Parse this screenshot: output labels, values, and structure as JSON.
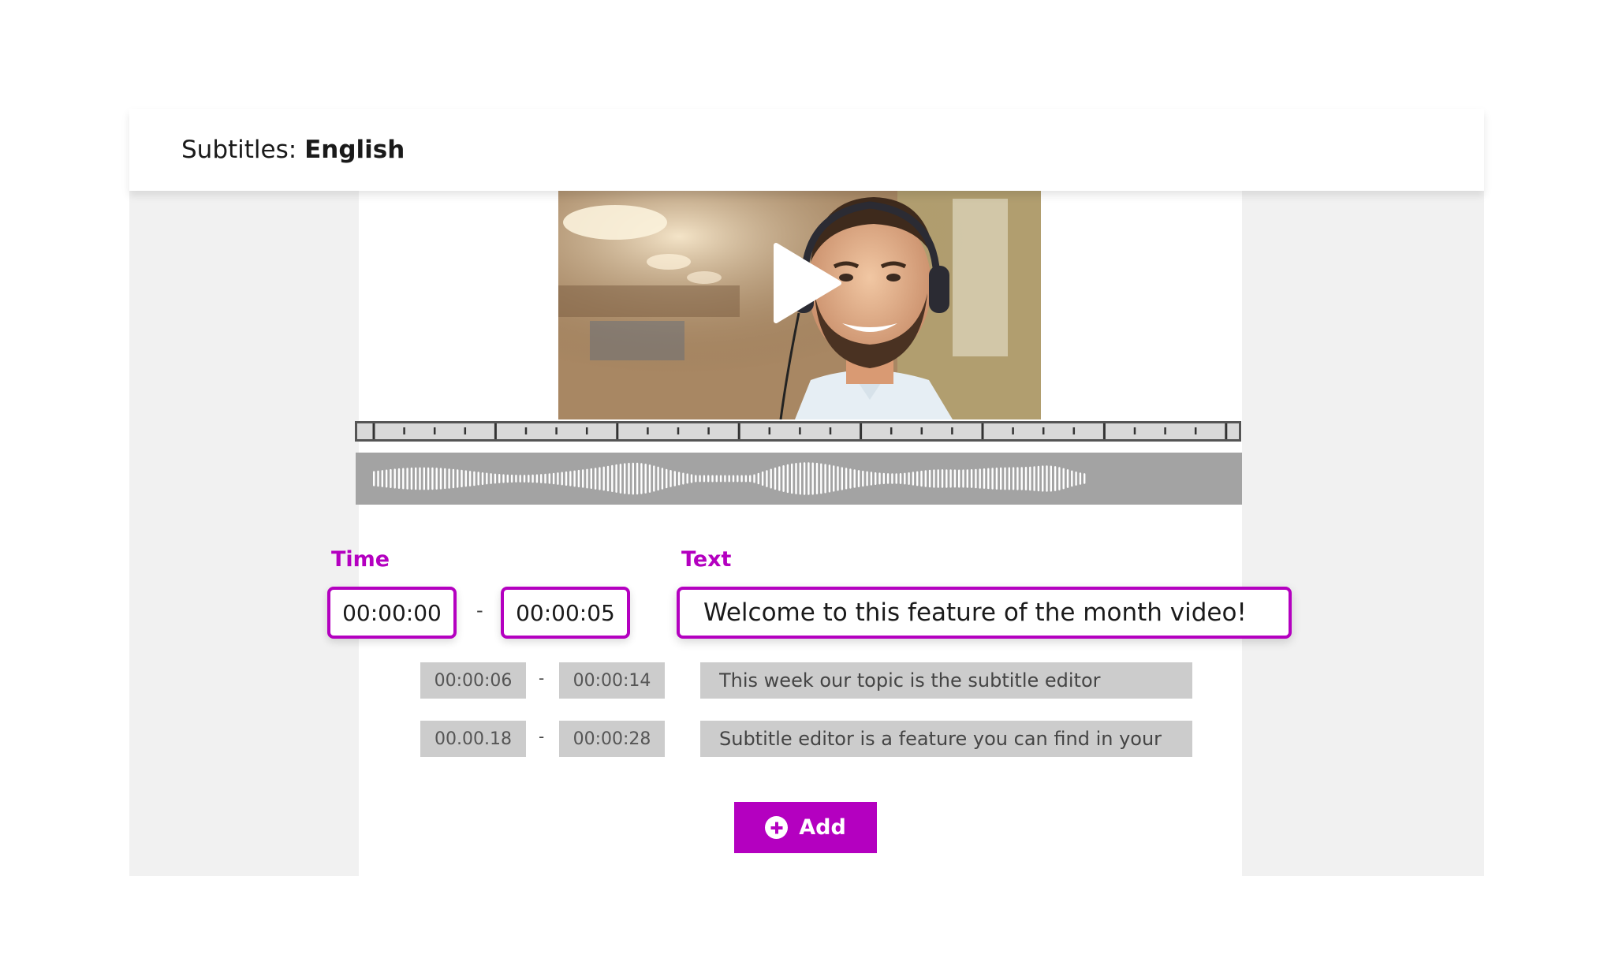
{
  "header": {
    "prefix": "Subtitles:",
    "language": "English"
  },
  "video": {
    "play_icon": "play-icon"
  },
  "editor": {
    "time_label": "Time",
    "text_label": "Text",
    "separator": "-",
    "active": {
      "start": "00:00:00",
      "end": "00:00:05",
      "text": "Welcome to this feature of the month video!"
    },
    "rows": [
      {
        "start": "00:00:06",
        "end": "00:00:14",
        "text": "This week our topic is the subtitle editor"
      },
      {
        "start": "00.00.18",
        "end": "00:00:28",
        "text": "Subtitle editor is a feature you can find in your"
      }
    ]
  },
  "add_button": {
    "label": "Add",
    "icon": "plus-circle-icon"
  },
  "colors": {
    "accent": "#b400c0",
    "waveform": "#a3a3a3",
    "row_background": "#cccccc"
  }
}
